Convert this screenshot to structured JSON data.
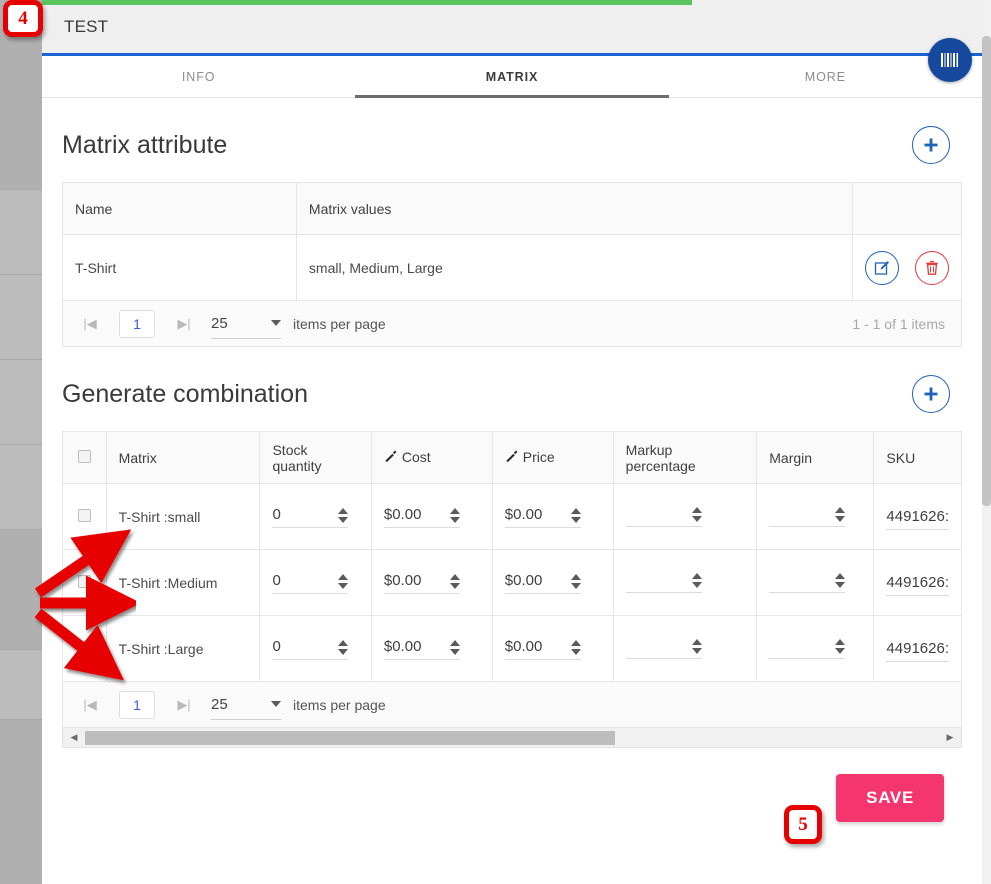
{
  "window": {
    "title": "TEST",
    "barcode_icon": "barcode-icon",
    "accent_blue": "#1a64d6",
    "top_accent_green": "#5cc45c"
  },
  "tabs": [
    {
      "label": "INFO",
      "active": false
    },
    {
      "label": "MATRIX",
      "active": true
    },
    {
      "label": "MORE",
      "active": false
    }
  ],
  "matrix_attribute": {
    "section_title": "Matrix attribute",
    "add_button_label": "+",
    "columns": [
      "Name",
      "Matrix values",
      ""
    ],
    "rows": [
      {
        "name": "T-Shirt",
        "values": "small, Medium, Large",
        "edit_icon": "edit-pencil-icon",
        "delete_icon": "trash-icon"
      }
    ],
    "pager": {
      "first_icon": "first-page-icon",
      "last_icon": "last-page-icon",
      "page": "1",
      "page_size": "25",
      "items_per_page_label": "items per page",
      "range_label": "1 - 1 of 1 items"
    }
  },
  "generate_combination": {
    "section_title": "Generate combination",
    "add_button_label": "+",
    "columns": [
      {
        "label": "",
        "icon": "select-all-checkbox"
      },
      {
        "label": "Matrix",
        "icon": ""
      },
      {
        "label": "Stock quantity",
        "icon": ""
      },
      {
        "label": "Cost",
        "icon": "magic-wand-icon"
      },
      {
        "label": "Price",
        "icon": "magic-wand-icon"
      },
      {
        "label": "Markup percentage",
        "icon": ""
      },
      {
        "label": "Margin",
        "icon": ""
      },
      {
        "label": "SKU",
        "icon": ""
      }
    ],
    "rows": [
      {
        "selected": false,
        "matrix": "T-Shirt :small",
        "stock_quantity": "0",
        "cost": "$0.00",
        "price": "$0.00",
        "markup_percentage": "",
        "margin": "",
        "sku": "4491626:"
      },
      {
        "selected": false,
        "matrix": "T-Shirt :Medium",
        "stock_quantity": "0",
        "cost": "$0.00",
        "price": "$0.00",
        "markup_percentage": "",
        "margin": "",
        "sku": "4491626:"
      },
      {
        "selected": false,
        "matrix": "T-Shirt :Large",
        "stock_quantity": "0",
        "cost": "$0.00",
        "price": "$0.00",
        "markup_percentage": "",
        "margin": "",
        "sku": "4491626:"
      }
    ],
    "pager": {
      "first_icon": "first-page-icon",
      "last_icon": "last-page-icon",
      "page": "1",
      "page_size": "25",
      "items_per_page_label": "items per page"
    },
    "horizontal_scrollbar": {
      "left_arrow": "scroll-left-icon",
      "right_arrow": "scroll-right-icon"
    }
  },
  "footer": {
    "save_label": "SAVE",
    "save_color": "#f5366e"
  },
  "annotations": [
    {
      "id": "step-4",
      "label": "4",
      "target": "matrix-row-labels"
    },
    {
      "id": "step-5",
      "label": "5",
      "target": "save-button"
    }
  ],
  "annotation_color": "#e60000"
}
